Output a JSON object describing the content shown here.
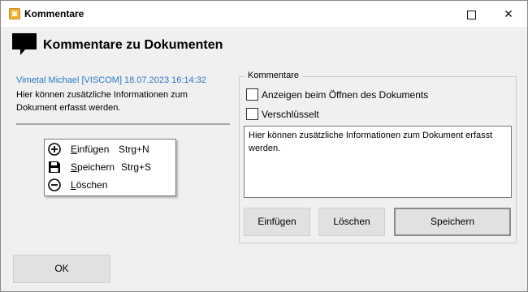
{
  "window": {
    "title": "Kommentare"
  },
  "header": {
    "title": "Kommentare zu Dokumenten"
  },
  "comment": {
    "meta": "Vimetal Michael [VISCOM] 18.07.2023 16:14:32",
    "text": "Hier können zusätzliche Informationen zum Dokument erfasst werden."
  },
  "context_menu": {
    "items": [
      {
        "label": "Einfügen",
        "shortcut": "Strg+N",
        "icon": "add-circle-icon"
      },
      {
        "label": "Speichern",
        "shortcut": "Strg+S",
        "icon": "floppy-disk-icon"
      },
      {
        "label": "Löschen",
        "shortcut": "",
        "icon": "remove-circle-icon"
      }
    ]
  },
  "comments_group": {
    "legend": "Kommentare",
    "checkbox_show_on_open": {
      "label": "Anzeigen beim Öffnen des Dokuments",
      "checked": false
    },
    "checkbox_encrypted": {
      "label": "Verschlüsselt",
      "checked": false
    },
    "textarea_value": "Hier können zusätzliche Informationen zum Dokument erfasst werden.",
    "buttons": {
      "insert": "Einfügen",
      "delete": "Löschen",
      "save": "Speichern"
    }
  },
  "footer": {
    "ok": "OK"
  }
}
